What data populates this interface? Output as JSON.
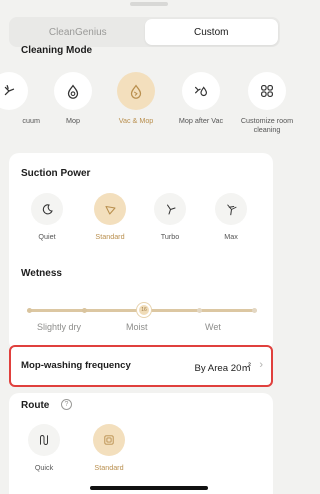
{
  "tabs": [
    {
      "label": "CleanGenius",
      "active": false
    },
    {
      "label": "Custom",
      "active": true
    }
  ],
  "cleaning_mode": {
    "title": "Cleaning Mode",
    "items": [
      {
        "label": "cuum",
        "icon": "vacuum-icon",
        "selected": false
      },
      {
        "label": "Mop",
        "icon": "mop-icon",
        "selected": false
      },
      {
        "label": "Vac & Mop",
        "icon": "vac-and-mop-icon",
        "selected": true
      },
      {
        "label": "Mop after Vac",
        "icon": "mop-after-vac-icon",
        "selected": false
      },
      {
        "label": "Customize room cleaning",
        "icon": "customize-rooms-icon",
        "selected": false
      }
    ]
  },
  "suction": {
    "title": "Suction Power",
    "items": [
      {
        "label": "Quiet",
        "icon": "quiet-icon",
        "selected": false
      },
      {
        "label": "Standard",
        "icon": "standard-icon",
        "selected": true
      },
      {
        "label": "Turbo",
        "icon": "turbo-icon",
        "selected": false
      },
      {
        "label": "Max",
        "icon": "max-icon",
        "selected": false
      }
    ]
  },
  "wetness": {
    "title": "Wetness",
    "knob_value": "16",
    "labels": [
      "Slightly dry",
      "Moist",
      "Wet"
    ]
  },
  "mop_washing": {
    "title": "Mop-washing frequency",
    "value": "By Area 20㎡"
  },
  "route": {
    "title": "Route",
    "items": [
      {
        "label": "Quick",
        "icon": "quick-route-icon",
        "selected": false
      },
      {
        "label": "Standard",
        "icon": "standard-route-icon",
        "selected": true
      }
    ]
  },
  "colors": {
    "accent": "#b98f4e",
    "accent_fill": "#f3dfbd",
    "highlight_border": "#e0403d"
  }
}
